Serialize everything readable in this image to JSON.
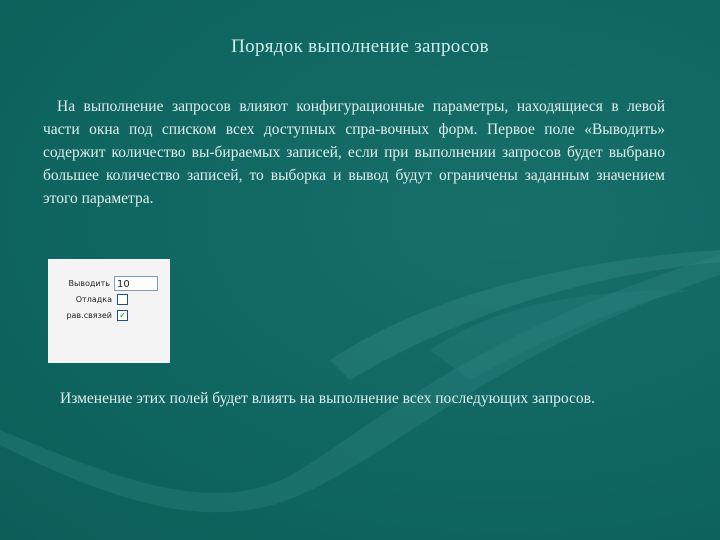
{
  "slide": {
    "title": "Порядок выполнение запросов",
    "paragraph1": "На выполнение запросов влияют конфигурационные параметры, находящиеся в левой части окна под списком всех доступных спра-вочных форм. Первое поле «Выводить» содержит количество вы-бираемых записей, если при выполнении запросов будет выбрано большее количество записей, то выборка и вывод будут ограничены заданным значением этого параметра.",
    "paragraph2": "Изменение этих полей будет влиять на выполнение всех последующих запросов."
  },
  "settings_panel": {
    "output_label": "Выводить",
    "output_value": "10",
    "debug_label": "Отладка",
    "debug_checked": false,
    "debug_mark": "",
    "links_label": "рав.связей",
    "links_checked": true,
    "links_mark": "✓"
  },
  "colors": {
    "background": "#0f6560",
    "title_text": "#cfeeea",
    "body_text": "#dfeeec",
    "panel_bg": "#f4f4f4"
  }
}
